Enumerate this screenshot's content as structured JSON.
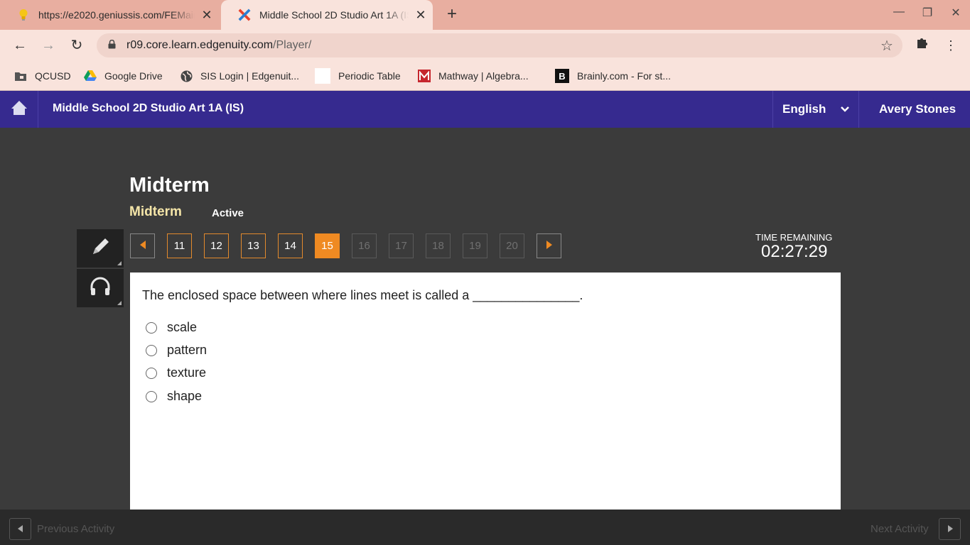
{
  "browser": {
    "tabs": [
      {
        "title": "https://e2020.geniussis.com/FEMain.aspx",
        "icon": "lightbulb-icon"
      },
      {
        "title": "Middle School 2D Studio Art 1A (IS)",
        "icon": "edgenuity-icon"
      }
    ],
    "url_host": "r09.core.learn.edgenuity.com",
    "url_path": "/Player/",
    "bookmarks": [
      {
        "label": "QCUSD",
        "icon": "folder-icon"
      },
      {
        "label": "Google Drive",
        "icon": "google-drive-icon"
      },
      {
        "label": "SIS Login | Edgenuit...",
        "icon": "globe-icon"
      },
      {
        "label": "Periodic Table",
        "icon": "blank-page-icon"
      },
      {
        "label": "Mathway | Algebra...",
        "icon": "mathway-icon"
      },
      {
        "label": "Brainly.com - For st...",
        "icon": "brainly-icon"
      }
    ]
  },
  "header": {
    "course_title": "Middle School 2D Studio Art 1A (IS)",
    "language": "English",
    "user": "Avery Stones"
  },
  "main": {
    "title": "Midterm",
    "subtitle": "Midterm",
    "status": "Active",
    "time_label": "TIME REMAINING",
    "time_value": "02:27:29",
    "questions": [
      {
        "num": "11",
        "state": "answered"
      },
      {
        "num": "12",
        "state": "answered"
      },
      {
        "num": "13",
        "state": "answered"
      },
      {
        "num": "14",
        "state": "answered"
      },
      {
        "num": "15",
        "state": "current"
      },
      {
        "num": "16",
        "state": "disabled"
      },
      {
        "num": "17",
        "state": "disabled"
      },
      {
        "num": "18",
        "state": "disabled"
      },
      {
        "num": "19",
        "state": "disabled"
      },
      {
        "num": "20",
        "state": "disabled"
      }
    ],
    "question": "The enclosed space between where lines meet is called a _______________.",
    "choices": [
      "scale",
      "pattern",
      "texture",
      "shape"
    ]
  },
  "footer": {
    "previous": "Previous Activity",
    "next": "Next Activity"
  },
  "colors": {
    "header_bg": "#362a8f",
    "accent_orange": "#ef8a22",
    "subtitle_yellow": "#f4e5a8",
    "tabstrip": "#e8aea0"
  }
}
